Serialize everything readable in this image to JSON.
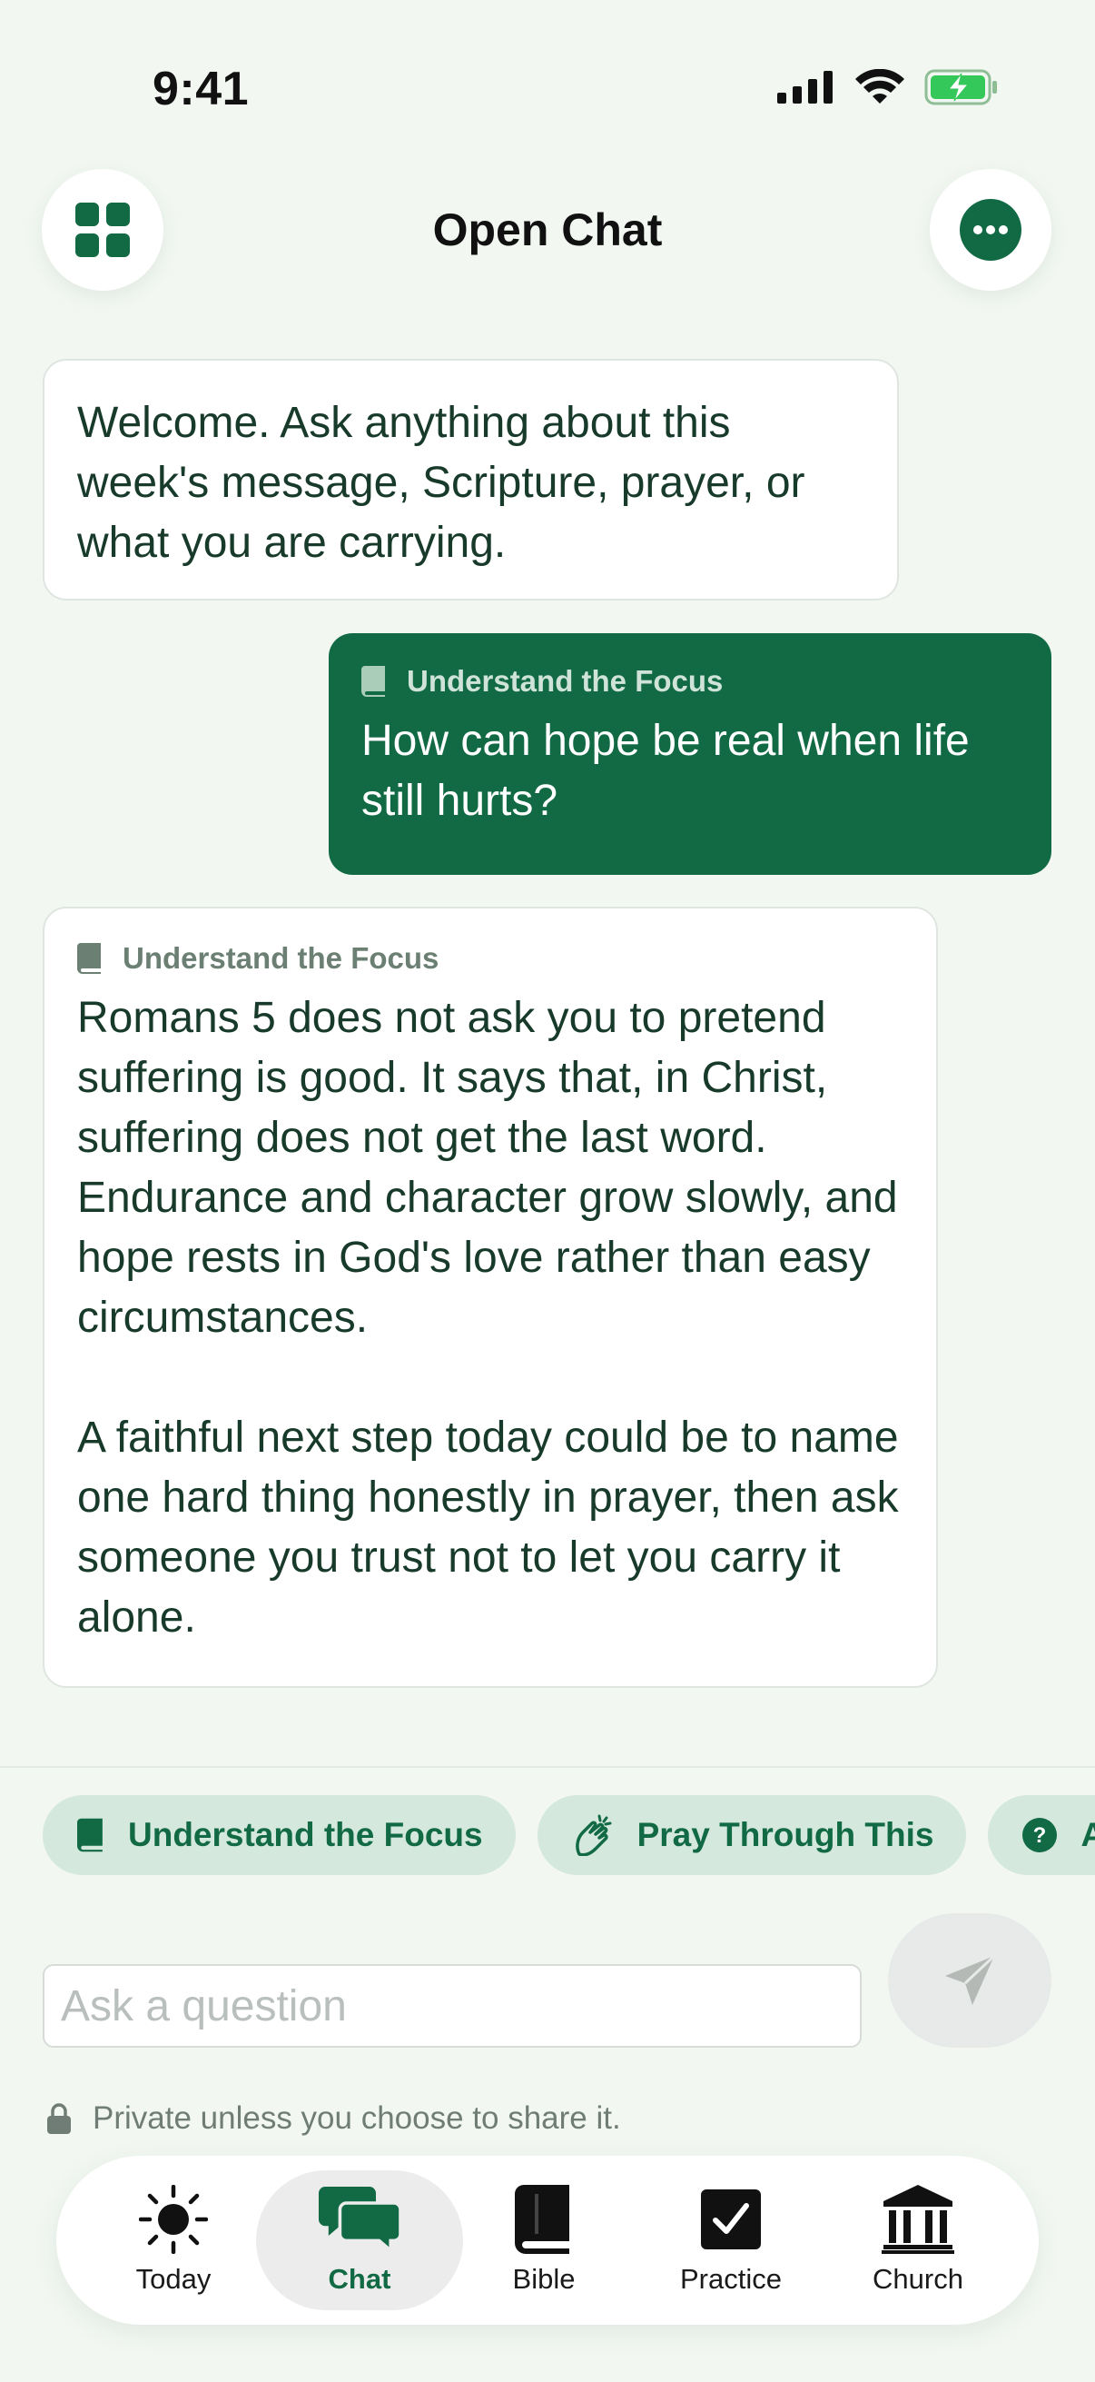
{
  "status": {
    "time": "9:41"
  },
  "header": {
    "title": "Open Chat"
  },
  "messages": [
    {
      "role": "assistant",
      "text": "Welcome. Ask anything about this week's message, Scripture, prayer, or what you are carrying."
    },
    {
      "role": "user",
      "tag": "Understand the Focus",
      "text": "How can hope be real when life still hurts?"
    },
    {
      "role": "assistant",
      "tag": "Understand the Focus",
      "paragraphs": [
        "Romans 5 does not ask you to pretend suffering is good. It says that, in Christ, suffering does not get the last word. Endurance and character grow slowly, and hope rests in God's love rather than easy circumstances.",
        "A faithful next step today could be to name one hard thing honestly in prayer, then ask someone you trust not to let you carry it alone."
      ]
    }
  ],
  "chips": [
    {
      "label": "Understand the Focus",
      "icon": "book-icon"
    },
    {
      "label": "Pray Through This",
      "icon": "praying-hands-icon"
    },
    {
      "label": "A",
      "icon": "question-icon"
    }
  ],
  "composer": {
    "placeholder": "Ask a question",
    "value": ""
  },
  "privacy_note": "Private unless you choose to share it.",
  "tabs": [
    {
      "label": "Today",
      "icon": "sun-icon"
    },
    {
      "label": "Chat",
      "icon": "chat-bubbles-icon",
      "active": true
    },
    {
      "label": "Bible",
      "icon": "bible-icon"
    },
    {
      "label": "Practice",
      "icon": "checkbox-icon"
    },
    {
      "label": "Church",
      "icon": "church-building-icon"
    }
  ],
  "colors": {
    "primary": "#116a44",
    "background": "#f2f7f2",
    "chip": "#d5e8dd",
    "text": "#173a2a"
  }
}
